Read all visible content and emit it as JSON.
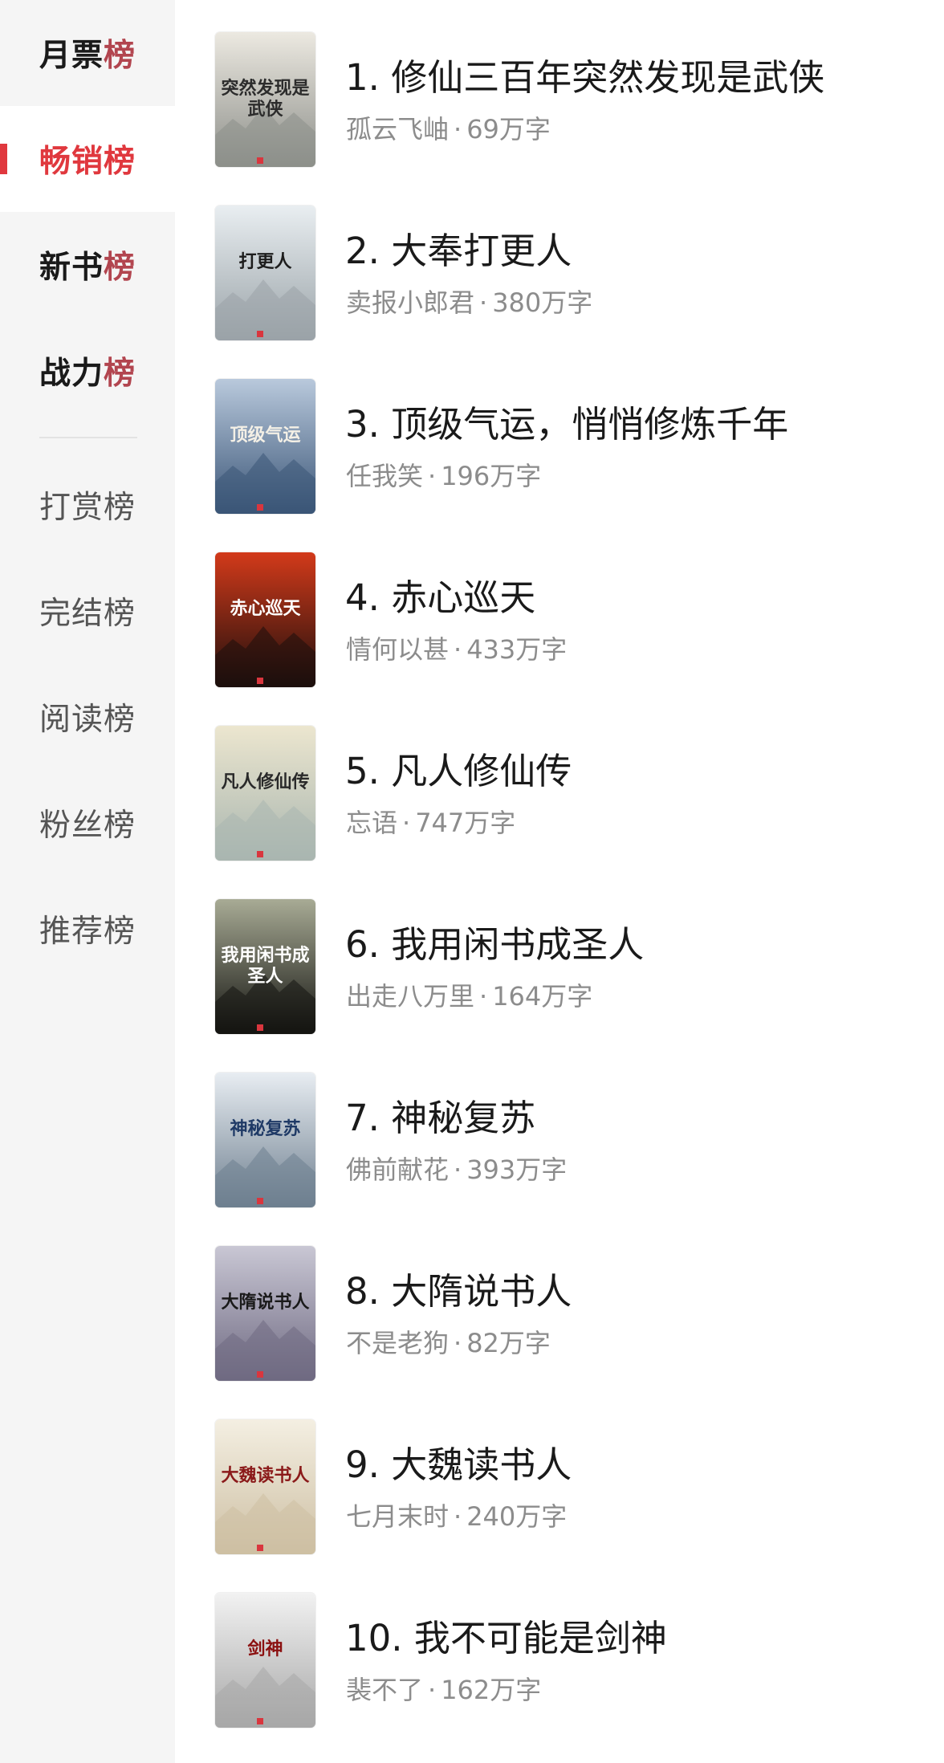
{
  "sidebar": {
    "tabs": [
      {
        "text": "月票",
        "last": "榜",
        "type": "primary",
        "active": false
      },
      {
        "text": "畅销",
        "last": "榜",
        "type": "primary",
        "active": true
      },
      {
        "text": "新书",
        "last": "榜",
        "type": "primary",
        "active": false
      },
      {
        "text": "战力",
        "last": "榜",
        "type": "primary",
        "active": false
      },
      {
        "text": "打赏榜",
        "type": "secondary"
      },
      {
        "text": "完结榜",
        "type": "secondary"
      },
      {
        "text": "阅读榜",
        "type": "secondary"
      },
      {
        "text": "粉丝榜",
        "type": "secondary"
      },
      {
        "text": "推荐榜",
        "type": "secondary"
      }
    ]
  },
  "colors": {
    "accent": "#e0383e",
    "sidebar_bg": "#f5f5f5",
    "title_text": "#1a1a1a",
    "meta_text": "#8c8c8c"
  },
  "books": [
    {
      "rank_title": "1. 修仙三百年突然发现是武侠",
      "author": "孤云飞岫",
      "sep": "·",
      "words": "69万字",
      "cover_text": "突然发现是武侠",
      "cover": {
        "top": "#ece9e1",
        "bottom": "#8d8f8a",
        "ink": "#2c2c2c"
      }
    },
    {
      "rank_title": "2. 大奉打更人",
      "author": "卖报小郎君",
      "sep": "·",
      "words": "380万字",
      "cover_text": "打更人",
      "cover": {
        "top": "#e9eef1",
        "bottom": "#9aa3a8",
        "ink": "#1d1d1d"
      }
    },
    {
      "rank_title": "3. 顶级气运，悄悄修炼千年",
      "author": "任我笑",
      "sep": "·",
      "words": "196万字",
      "cover_text": "顶级气运",
      "cover": {
        "top": "#b9c9dc",
        "bottom": "#3a5577",
        "ink": "#f4f0e6"
      }
    },
    {
      "rank_title": "4. 赤心巡天",
      "author": "情何以甚",
      "sep": "·",
      "words": "433万字",
      "cover_text": "赤心巡天",
      "cover": {
        "top": "#d33a1a",
        "bottom": "#1c0f0d",
        "ink": "#ffffff"
      }
    },
    {
      "rank_title": "5. 凡人修仙传",
      "author": "忘语",
      "sep": "·",
      "words": "747万字",
      "cover_text": "凡人修仙传",
      "cover": {
        "top": "#ece6cf",
        "bottom": "#a9b6b0",
        "ink": "#2a2a2a"
      }
    },
    {
      "rank_title": "6. 我用闲书成圣人",
      "author": "出走八万里",
      "sep": "·",
      "words": "164万字",
      "cover_text": "我用闲书成圣人",
      "cover": {
        "top": "#a8ab95",
        "bottom": "#141411",
        "ink": "#ffffff"
      }
    },
    {
      "rank_title": "7. 神秘复苏",
      "author": "佛前献花",
      "sep": "·",
      "words": "393万字",
      "cover_text": "神秘复苏",
      "cover": {
        "top": "#e8edf2",
        "bottom": "#6e7f8f",
        "ink": "#1f3a66"
      }
    },
    {
      "rank_title": "8. 大隋说书人",
      "author": "不是老狗",
      "sep": "·",
      "words": "82万字",
      "cover_text": "大隋说书人",
      "cover": {
        "top": "#c9c7d4",
        "bottom": "#6f6a82",
        "ink": "#1a1a1a"
      }
    },
    {
      "rank_title": "9. 大魏读书人",
      "author": "七月末时",
      "sep": "·",
      "words": "240万字",
      "cover_text": "大魏读书人",
      "cover": {
        "top": "#f4efe2",
        "bottom": "#cdbfa3",
        "ink": "#8b1a1a"
      }
    },
    {
      "rank_title": "10. 我不可能是剑神",
      "author": "裴不了",
      "sep": "·",
      "words": "162万字",
      "cover_text": "剑神",
      "cover": {
        "top": "#f2f2f2",
        "bottom": "#a7a7a7",
        "ink": "#8b1010"
      }
    }
  ]
}
